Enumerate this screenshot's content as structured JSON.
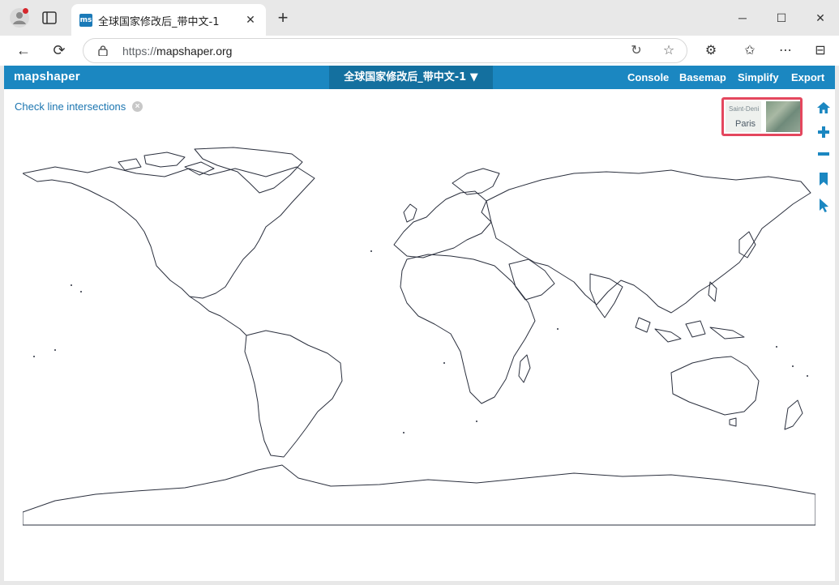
{
  "browser": {
    "tab_title": "全球国家修改后_带中文-1",
    "favicon_text": "ms",
    "url_protocol": "https://",
    "url_host": "mapshaper.org",
    "tab_close": "✕",
    "new_tab": "+",
    "window": {
      "minimize": "─",
      "maximize": "☐",
      "close": "✕"
    }
  },
  "app": {
    "logo": "mapshaper",
    "layer_menu": "全球国家修改后_带中文-1 ▼",
    "menu": {
      "console": "Console",
      "basemap": "Basemap",
      "simplify": "Simplify",
      "export": "Export"
    },
    "check_intersections": "Check line intersections",
    "basemap_preview": {
      "label_small": "Saint-Deni",
      "label_city": "Paris"
    },
    "colors": {
      "header": "#1b87c1",
      "layer_bg": "#14709f",
      "link": "#1b75b0",
      "highlight": "#e4475e",
      "map_stroke": "#2a2f3d"
    },
    "tools": [
      "home-icon",
      "zoom-in-icon",
      "zoom-out-icon",
      "bookmark-icon",
      "pointer-icon"
    ]
  }
}
